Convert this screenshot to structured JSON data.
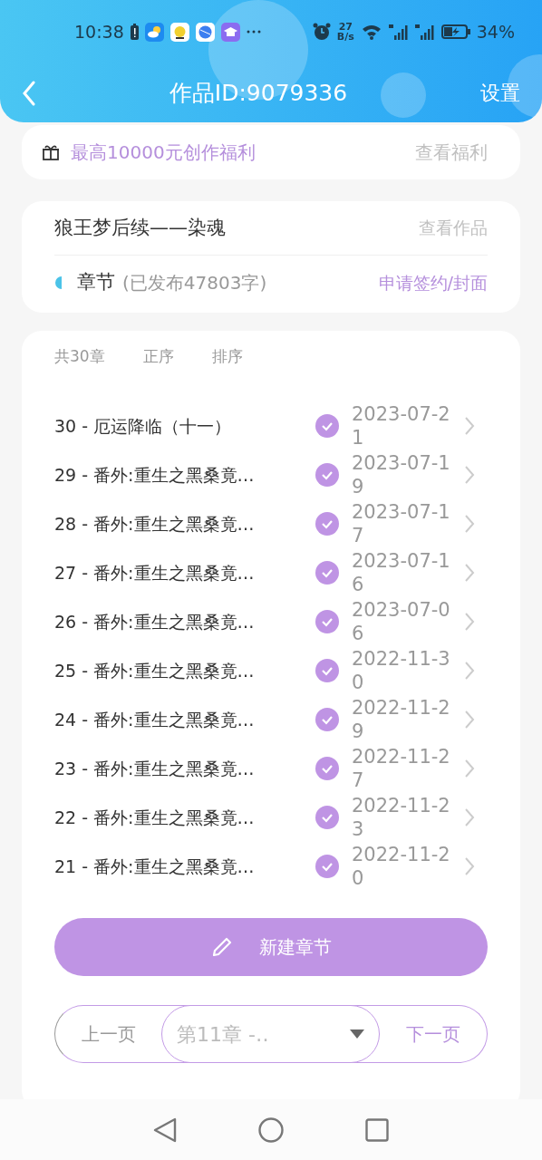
{
  "status_bar": {
    "time": "10:38",
    "net_speed_value": "27",
    "net_speed_unit": "B/s",
    "battery": "34%"
  },
  "header": {
    "title": "作品ID:9079336",
    "action": "设置"
  },
  "promo": {
    "text": "最高10000元创作福利",
    "link": "查看福利"
  },
  "work": {
    "title": "狼王梦后续——染魂",
    "view_link": "查看作品",
    "section_label": "章节",
    "section_info": "(已发布47803字)",
    "sign_link": "申请签约/封面"
  },
  "chapter_list": {
    "count": "共30章",
    "order": "正序",
    "sort": "排序",
    "rows": [
      {
        "title": "30 - 厄运降临（十一）",
        "published": true,
        "date": "2023-07-21"
      },
      {
        "title": "29 - 番外:重生之黑桑竟…",
        "published": true,
        "date": "2023-07-19"
      },
      {
        "title": "28 - 番外:重生之黑桑竟…",
        "published": true,
        "date": "2023-07-17"
      },
      {
        "title": "27 - 番外:重生之黑桑竟…",
        "published": true,
        "date": "2023-07-16"
      },
      {
        "title": "26 - 番外:重生之黑桑竟…",
        "published": true,
        "date": "2023-07-06"
      },
      {
        "title": "25 - 番外:重生之黑桑竟…",
        "published": true,
        "date": "2022-11-30"
      },
      {
        "title": "24 - 番外:重生之黑桑竟…",
        "published": true,
        "date": "2022-11-29"
      },
      {
        "title": "23 - 番外:重生之黑桑竟…",
        "published": true,
        "date": "2022-11-27"
      },
      {
        "title": "22 - 番外:重生之黑桑竟…",
        "published": true,
        "date": "2022-11-23"
      },
      {
        "title": "21 - 番外:重生之黑桑竟…",
        "published": true,
        "date": "2022-11-20"
      }
    ]
  },
  "new_button": "新建章节",
  "pager": {
    "prev": "上一页",
    "current": "第11章 -‥",
    "next": "下一页"
  }
}
